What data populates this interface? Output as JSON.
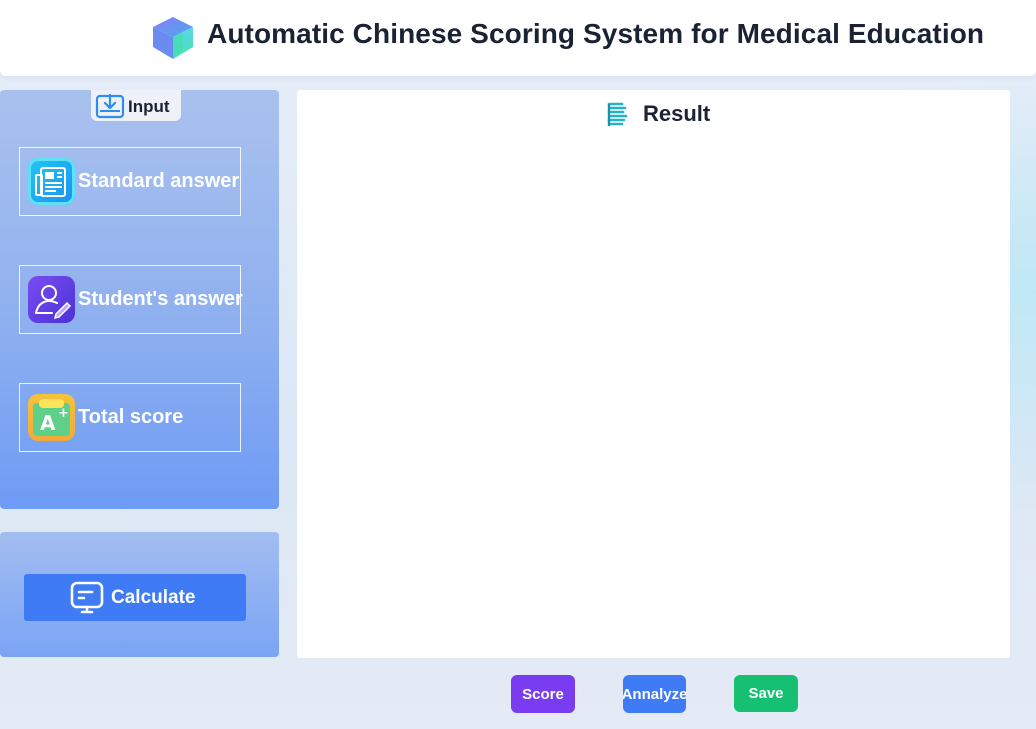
{
  "header": {
    "title": "Automatic Chinese Scoring System for Medical Education"
  },
  "input_panel": {
    "tab_label": "Input",
    "items": [
      {
        "label": "Standard answer",
        "icon": "newspaper-icon"
      },
      {
        "label": "Student's answer",
        "icon": "user-edit-icon"
      },
      {
        "label": "Total score",
        "icon": "grade-a-plus-icon"
      }
    ]
  },
  "calculate": {
    "label": "Calculate",
    "icon": "monitor-icon"
  },
  "result": {
    "title": "Result",
    "icon": "result-stripes-icon"
  },
  "actions": {
    "score": "Score",
    "analyze": "Annalyze",
    "save": "Save"
  },
  "colors": {
    "accent_blue": "#3f7bf4",
    "score_purple": "#7a3cf0",
    "analyze_blue": "#3f7bf4",
    "save_green": "#16c072"
  }
}
